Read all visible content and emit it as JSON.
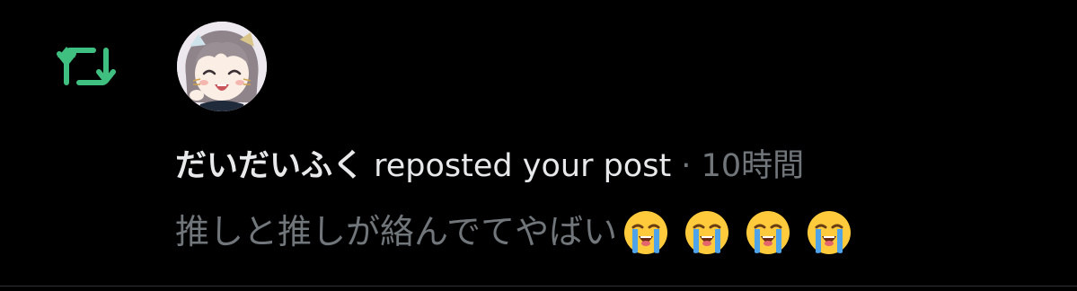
{
  "notification": {
    "icon": "repost-icon",
    "user_name": "だいだいふく",
    "action": " reposted your post",
    "separator": " · ",
    "time": "10時間",
    "post_text": "推しと推しが絡んでてやばい",
    "emojis": [
      "loudly-crying-face-emoji",
      "loudly-crying-face-emoji",
      "loudly-crying-face-emoji",
      "loudly-crying-face-emoji"
    ]
  },
  "colors": {
    "background": "#000000",
    "repost_green": "#3fbf80",
    "primary_text": "#e7e9ea",
    "secondary_text": "#71767b"
  }
}
